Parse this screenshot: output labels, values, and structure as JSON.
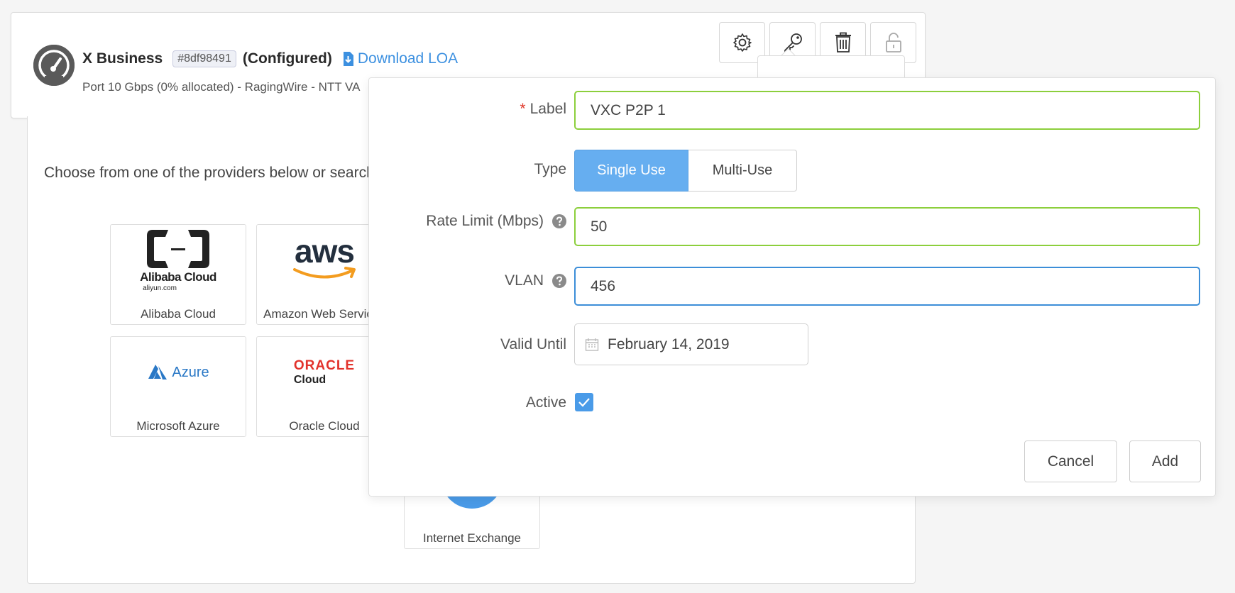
{
  "port": {
    "name": "X Business",
    "id": "#8df98491",
    "status": "(Configured)",
    "download_label": "Download LOA",
    "subtitle": "Port 10 Gbps (0% allocated) - RagingWire - NTT VA"
  },
  "toolbar": {
    "settings_icon": "gear-icon",
    "key_icon": "key-icon",
    "delete_icon": "trash-icon",
    "lock_icon": "unlock-icon"
  },
  "providers": {
    "intro": "Choose from one of the providers below or search",
    "tiles": [
      {
        "label": "Alibaba Cloud",
        "logo_text": "Alibaba Cloud",
        "logo_sub": "aliyun.com"
      },
      {
        "label": "Amazon Web Services",
        "logo_text": "aws"
      },
      {
        "label": "Microsoft Azure",
        "logo_text": "Azure"
      },
      {
        "label": "Oracle Cloud",
        "logo_text": "ORACLE",
        "logo_sub": "Cloud"
      },
      {
        "label": "Internet Exchange"
      }
    ]
  },
  "form": {
    "label_label": "Label",
    "label_value": "VXC P2P 1",
    "type_label": "Type",
    "type_options": [
      "Single Use",
      "Multi-Use"
    ],
    "type_selected": "Single Use",
    "rate_label": "Rate Limit (Mbps)",
    "rate_value": "50",
    "vlan_label": "VLAN",
    "vlan_value": "456",
    "valid_label": "Valid Until",
    "valid_value": "February 14, 2019",
    "active_label": "Active",
    "active_checked": true,
    "cancel_label": "Cancel",
    "add_label": "Add"
  },
  "colors": {
    "accent": "#3c90e0",
    "valid_border": "#8ccf3c",
    "focus_border": "#3c8ed8",
    "active_toggle": "#66aef0",
    "required": "#e0392b"
  }
}
